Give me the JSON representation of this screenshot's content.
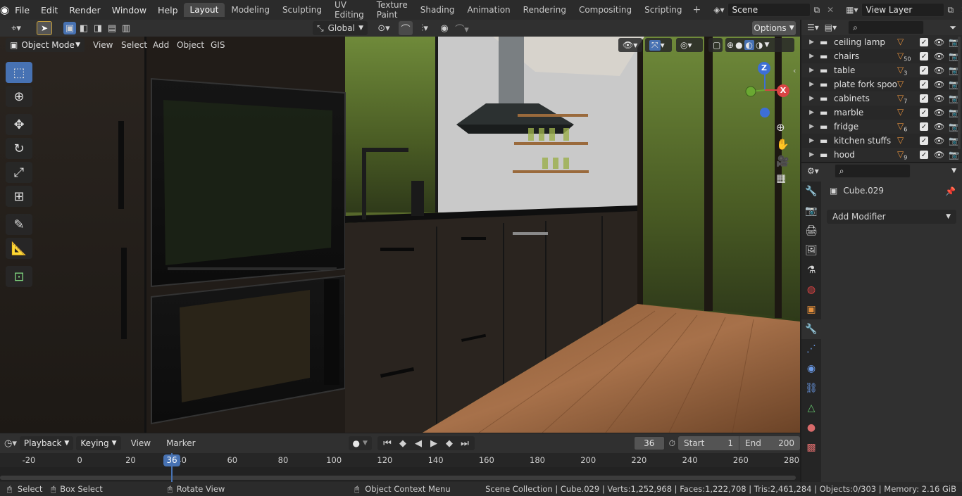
{
  "topbar": {
    "menus": [
      "File",
      "Edit",
      "Render",
      "Window",
      "Help"
    ],
    "workspaces": [
      "Layout",
      "Modeling",
      "Sculpting",
      "UV Editing",
      "Texture Paint",
      "Shading",
      "Animation",
      "Rendering",
      "Compositing",
      "Scripting"
    ],
    "active_workspace": "Layout",
    "scene": "Scene",
    "view_layer": "View Layer"
  },
  "toolbar": {
    "orientation": "Global",
    "options_label": "Options"
  },
  "viewport_header": {
    "mode": "Object Mode",
    "menus": [
      "View",
      "Select",
      "Add",
      "Object",
      "GIS"
    ]
  },
  "gizmo": {
    "z": "Z",
    "x": "X"
  },
  "outliner": {
    "items": [
      {
        "label": "ceiling lamp",
        "badge": ""
      },
      {
        "label": "chairs",
        "badge": "50"
      },
      {
        "label": "table",
        "badge": "3"
      },
      {
        "label": "plate fork spoon",
        "badge": ""
      },
      {
        "label": "cabinets",
        "badge": "7"
      },
      {
        "label": "marble",
        "badge": ""
      },
      {
        "label": "fridge",
        "badge": "6"
      },
      {
        "label": "kitchen stuffs",
        "badge": ""
      },
      {
        "label": "hood",
        "badge": "9"
      }
    ]
  },
  "properties": {
    "object_name": "Cube.029",
    "add_modifier": "Add Modifier"
  },
  "timeline": {
    "menus": [
      "Playback",
      "Keying",
      "View",
      "Marker"
    ],
    "current_frame": "36",
    "start_label": "Start",
    "start": "1",
    "end_label": "End",
    "end": "200",
    "ticks": [
      "-20",
      "0",
      "20",
      "40",
      "60",
      "80",
      "100",
      "120",
      "140",
      "160",
      "180",
      "200",
      "220",
      "240",
      "260",
      "280"
    ]
  },
  "statusbar": {
    "select": "Select",
    "box_select": "Box Select",
    "rotate_view": "Rotate View",
    "context_menu": "Object Context Menu",
    "stats": "Scene Collection | Cube.029 | Verts:1,252,968 | Faces:1,222,708 | Tris:2,461,284 | Objects:0/303 | Memory: 2.16 GiB"
  }
}
